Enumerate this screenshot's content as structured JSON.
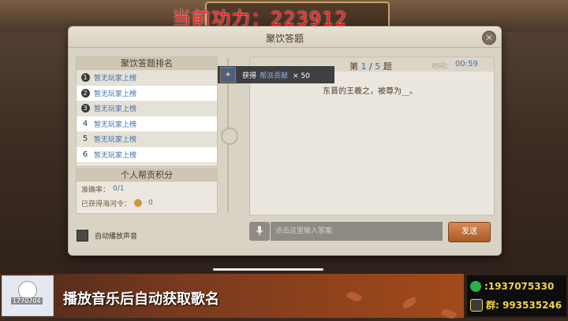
{
  "overlay": {
    "power_text": "当前功力：223912",
    "banner_text": "播放音乐后自动获取歌名",
    "avatar_id": "1770704",
    "contacts": [
      {
        "icon": "wechat-icon",
        "label": ":1937075330"
      },
      {
        "icon": "qq-group-icon",
        "label": "群: 993535246"
      }
    ]
  },
  "dialog": {
    "title": "聚饮答题",
    "close_icon": "×"
  },
  "ranking": {
    "header": "聚饮答题排名",
    "rows": [
      {
        "rank": "1",
        "name": "暂无玩家上榜"
      },
      {
        "rank": "2",
        "name": "暂无玩家上榜"
      },
      {
        "rank": "3",
        "name": "暂无玩家上榜"
      },
      {
        "rank": "4",
        "name": "暂无玩家上榜"
      },
      {
        "rank": "5",
        "name": "暂无玩家上榜"
      },
      {
        "rank": "6",
        "name": "暂无玩家上榜"
      }
    ]
  },
  "score": {
    "header": "个人帮贡积分",
    "accuracy_label": "准确率：",
    "accuracy_value": "0/1",
    "earned_label": "已获得海河令：",
    "earned_value": "0"
  },
  "autoplay": {
    "label": "自动播放声音"
  },
  "question": {
    "prefix": "第",
    "current": "1",
    "separator": "/",
    "total": "5",
    "suffix": "题",
    "time_label": "时间：",
    "time_value": "00:59",
    "text": "东晋的王羲之，被尊为__。"
  },
  "reward": {
    "label": "获得",
    "item": "帮派贡献",
    "amount": "× 50"
  },
  "input": {
    "placeholder": "点击这里输入答案",
    "send_label": "发送"
  }
}
